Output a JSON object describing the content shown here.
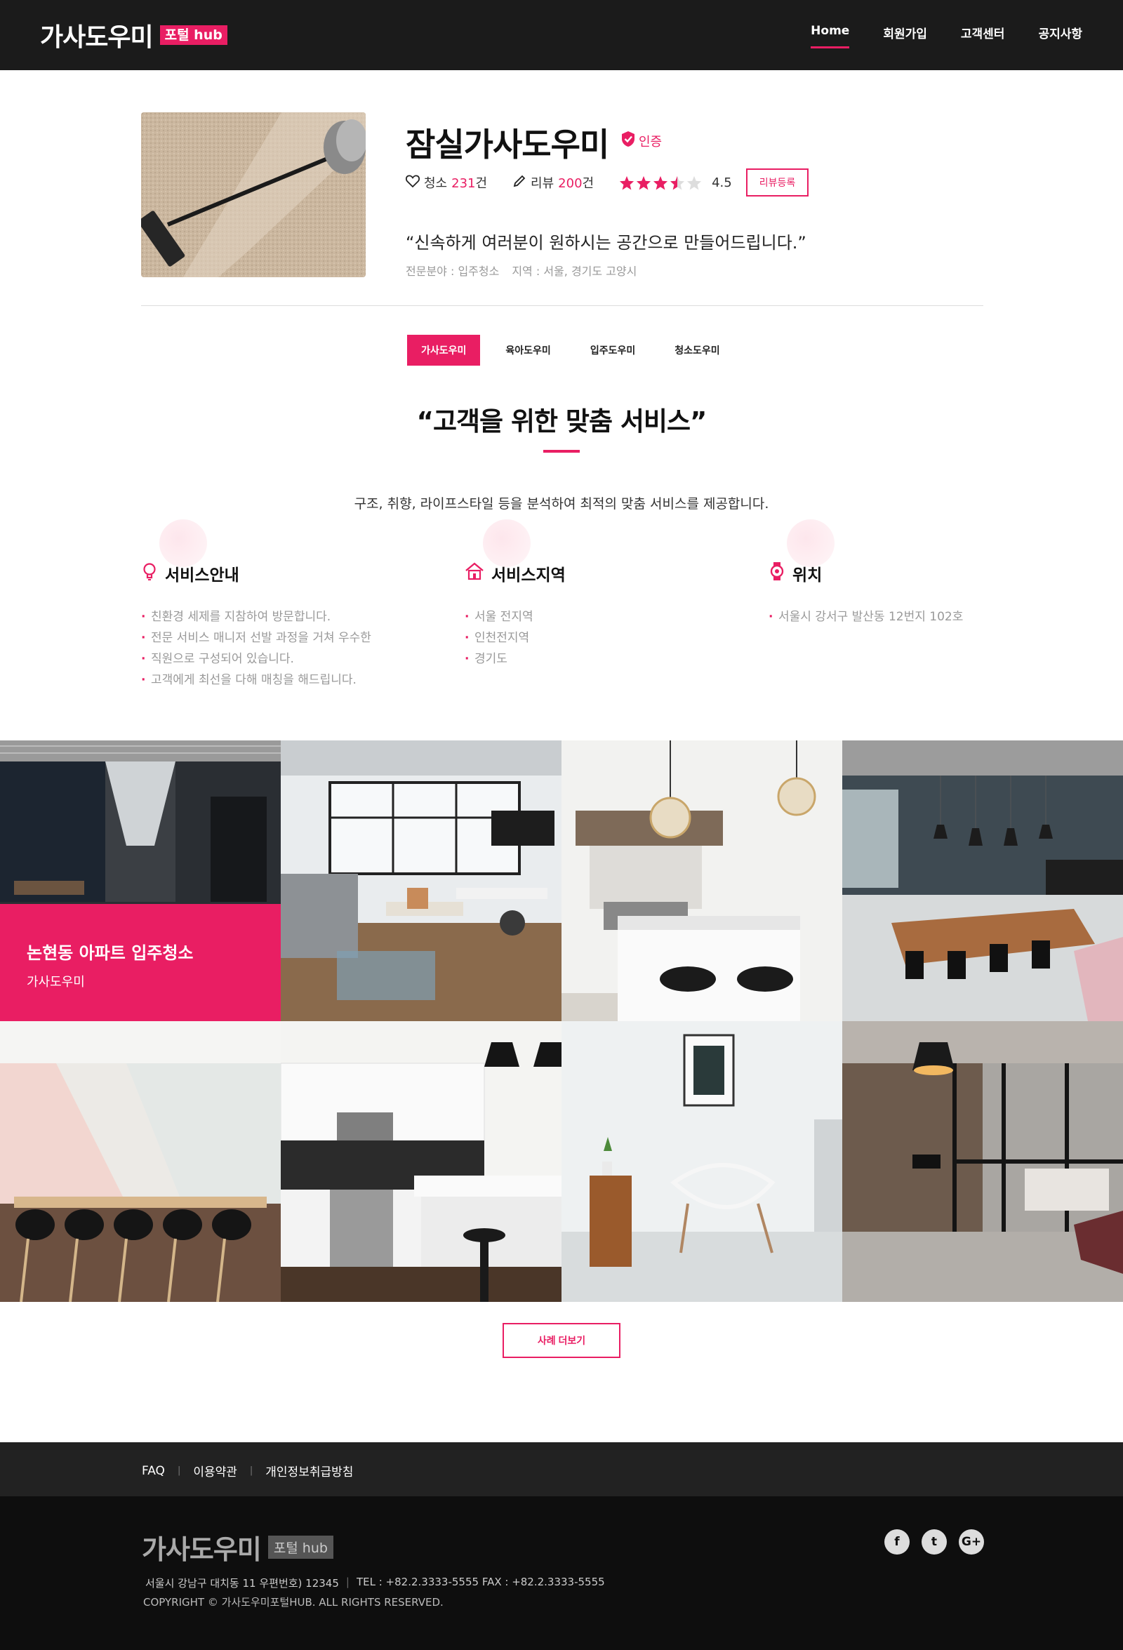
{
  "header": {
    "logo_text": "가사도우미",
    "logo_badge": "포털 hub",
    "nav": [
      "Home",
      "회원가입",
      "고객센터",
      "공지사항"
    ]
  },
  "profile": {
    "name": "잠실가사도우미",
    "cert_label": "인증",
    "clean_label": "청소",
    "clean_count": "231",
    "clean_unit": "건",
    "review_label": "리뷰",
    "review_count": "200",
    "review_unit": "건",
    "rating": 4.5,
    "rating_text": "4.5",
    "review_button": "리뷰등록",
    "quote": "“신속하게 여러분이 원하시는 공간으로 만들어드립니다.”",
    "specialty": "전문분야 : 입주청소",
    "region": "지역 : 서울, 경기도 고양시"
  },
  "tabs": [
    "가사도우미",
    "육아도우미",
    "입주도우미",
    "청소도우미"
  ],
  "section": {
    "title": "“고객을 위한 맞춤 서비스”",
    "description": "구조, 취향, 라이프스타일 등을 분석하여 최적의 맞춤 서비스를 제공합니다."
  },
  "info": [
    {
      "icon": "lightbulb-icon",
      "title": "서비스안내",
      "items": [
        "친환경 세제를 지참하여 방문합니다.",
        "전문 서비스 매니저 선발 과정을 거쳐 우수한",
        "직원으로  구성되어 있습니다.",
        "고객에게 최선을 다해 매칭을 해드립니다."
      ]
    },
    {
      "icon": "house-icon",
      "title": "서비스지역",
      "items": [
        "서울 전지역",
        "인천전지역",
        "경기도"
      ]
    },
    {
      "icon": "watch-icon",
      "title": "위치",
      "items": [
        "서울시 강서구 발산동 12번지 102호"
      ]
    }
  ],
  "gallery": {
    "overlay_title": "논현동 아파트 입주청소",
    "overlay_sub": "가사도우미"
  },
  "more_button": "사례 더보기",
  "footer": {
    "links": [
      "FAQ",
      "이용약관",
      "개인정보취급방침"
    ],
    "logo_text": "가사도우미",
    "logo_badge": "포털 hub",
    "address": "서울시 강남구 대치동 11 우편번호) 12345",
    "tel_fax": "TEL : +82.2.3333-5555  FAX : +82.2.3333-5555",
    "copyright": "COPYRIGHT © 가사도우미포털HUB. ALL RIGHTS RESERVED.",
    "social": [
      "f",
      "t",
      "G+"
    ]
  },
  "colors": {
    "accent": "#e91e63",
    "header_bg": "#1b1b1b",
    "footer_top": "#222222",
    "footer_bottom": "#0e0e0e"
  }
}
